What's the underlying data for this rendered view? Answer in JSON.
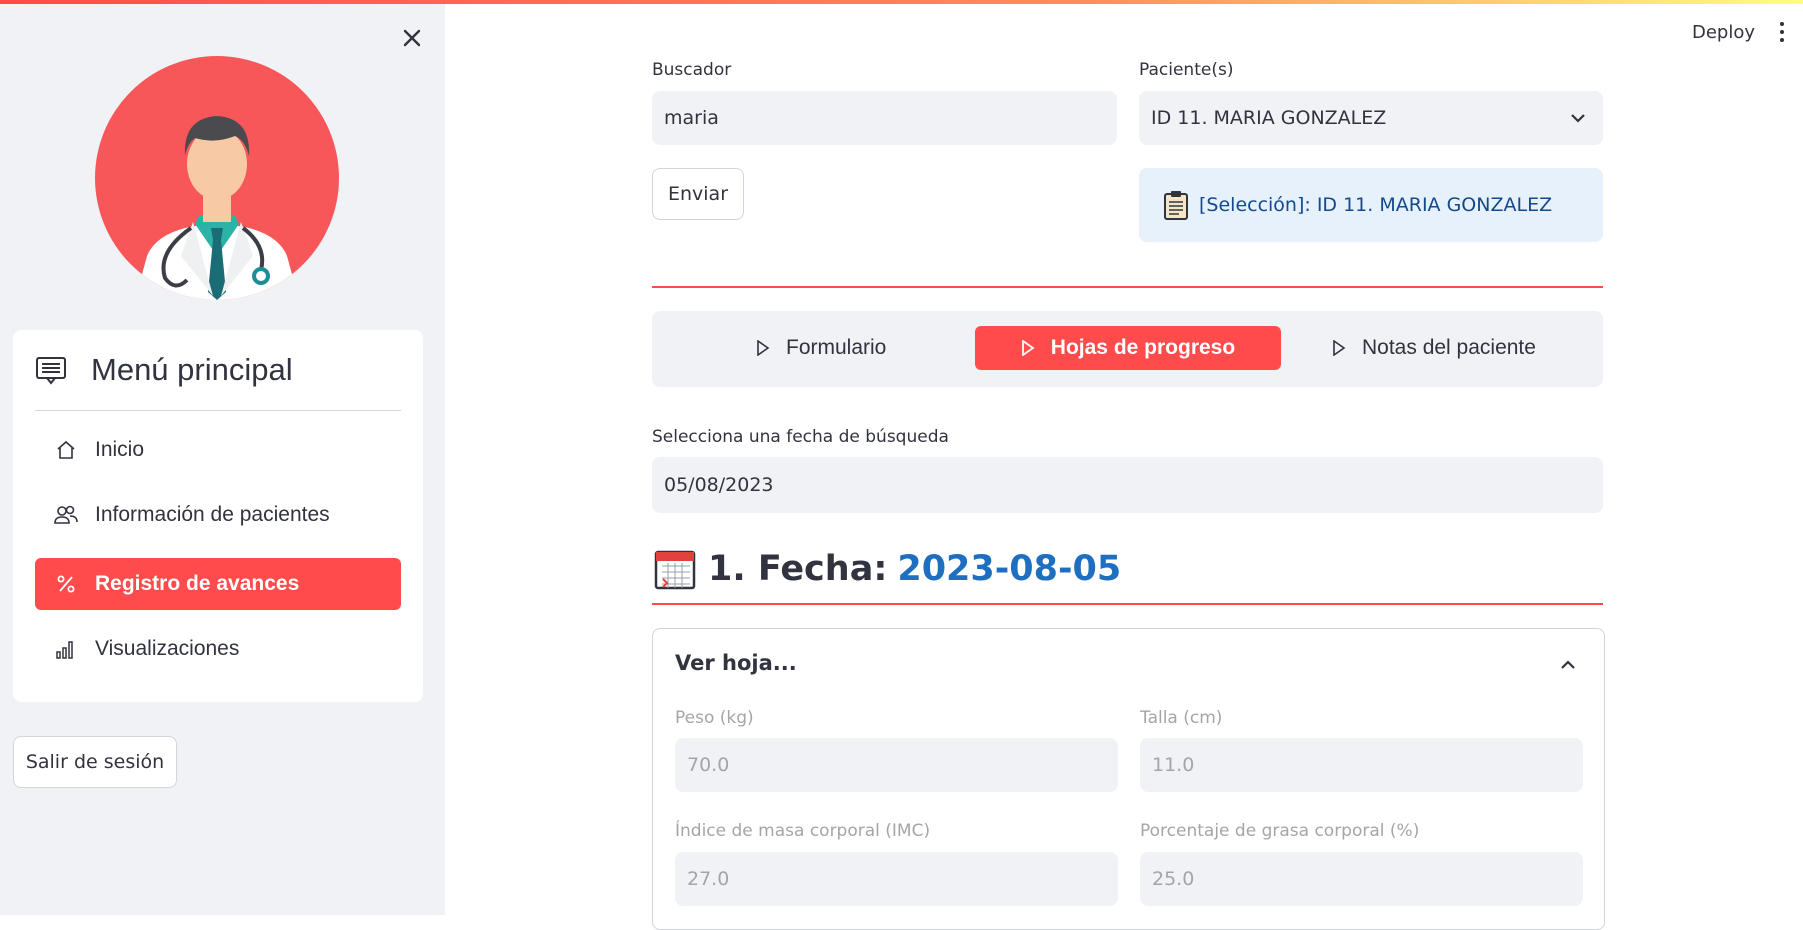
{
  "sidebar": {
    "menu_title": "Menú principal",
    "items": [
      {
        "label": "Inicio",
        "icon": "home-icon"
      },
      {
        "label": "Información de pacientes",
        "icon": "people-icon"
      },
      {
        "label": "Registro de avances",
        "icon": "percent-icon",
        "active": true
      },
      {
        "label": "Visualizaciones",
        "icon": "bar-chart-icon"
      }
    ],
    "logout_label": "Salir de sesión"
  },
  "header": {
    "deploy_label": "Deploy"
  },
  "search": {
    "label": "Buscador",
    "value": "maria",
    "submit_label": "Enviar"
  },
  "patients": {
    "label": "Paciente(s)",
    "selected": "ID 11. MARIA GONZALEZ",
    "selection_info": "[Selección]: ID 11. MARIA GONZALEZ"
  },
  "tabs": [
    {
      "label": "Formulario"
    },
    {
      "label": "Hojas de progreso",
      "active": true
    },
    {
      "label": "Notas del paciente"
    }
  ],
  "date_search": {
    "label": "Selecciona una fecha de búsqueda",
    "value": "05/08/2023"
  },
  "entry": {
    "heading_prefix": "1. Fecha:",
    "date": "2023-08-05",
    "expander_title": "Ver hoja...",
    "fields": [
      {
        "label": "Peso (kg)",
        "value": "70.0"
      },
      {
        "label": "Talla (cm)",
        "value": "11.0"
      },
      {
        "label": "Índice de masa corporal (IMC)",
        "value": "27.0"
      },
      {
        "label": "Porcentaje de grasa corporal (%)",
        "value": "25.0"
      }
    ]
  },
  "colors": {
    "accent": "#ff4b4b",
    "info_bg": "#e7f1fb",
    "date_blue": "#1f6fc1"
  }
}
